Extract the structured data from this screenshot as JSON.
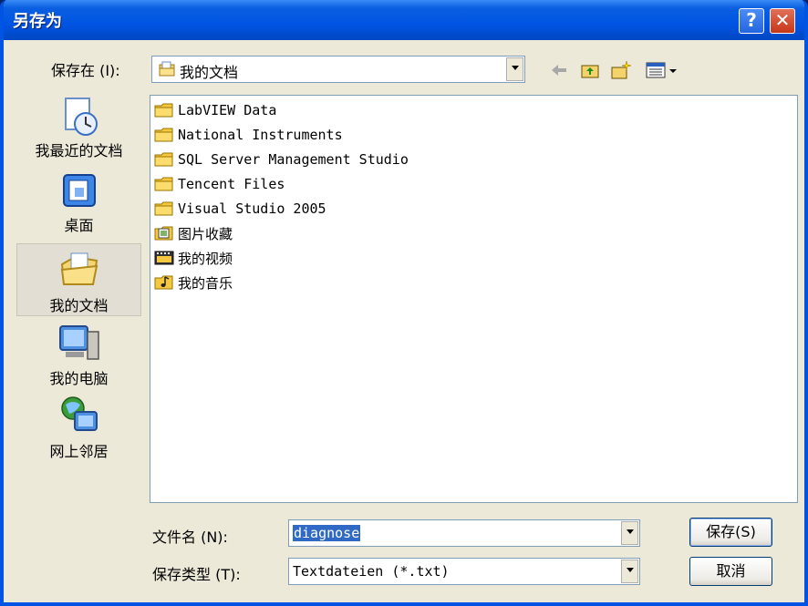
{
  "window": {
    "title": "另存为"
  },
  "titlebar": {
    "help_label": "?",
    "close_label": "✕"
  },
  "save_in": {
    "label": "保存在 (I):",
    "value": "我的文档"
  },
  "places": [
    {
      "label": "我最近的文档",
      "icon": "recent-documents-icon"
    },
    {
      "label": "桌面",
      "icon": "desktop-icon"
    },
    {
      "label": "我的文档",
      "icon": "my-documents-icon",
      "selected": true
    },
    {
      "label": "我的电脑",
      "icon": "my-computer-icon"
    },
    {
      "label": "网上邻居",
      "icon": "network-places-icon"
    }
  ],
  "files": [
    {
      "name": "LabVIEW Data",
      "icon": "folder-icon"
    },
    {
      "name": "National Instruments",
      "icon": "folder-icon"
    },
    {
      "name": "SQL Server Management Studio",
      "icon": "folder-icon"
    },
    {
      "name": "Tencent Files",
      "icon": "folder-icon"
    },
    {
      "name": "Visual Studio 2005",
      "icon": "folder-icon"
    },
    {
      "name": "图片收藏",
      "icon": "my-pictures-icon"
    },
    {
      "name": "我的视频",
      "icon": "my-videos-icon"
    },
    {
      "name": "我的音乐",
      "icon": "my-music-icon"
    }
  ],
  "filename": {
    "label": "文件名 (N):",
    "value": "diagnose"
  },
  "filetype": {
    "label": "保存类型 (T):",
    "value": "Textdateien (*.txt)"
  },
  "buttons": {
    "save": "保存(S)",
    "cancel": "取消"
  },
  "colors": {
    "titlebar": "#0054e3",
    "dialog_bg": "#ece9d8",
    "selection": "#316ac5",
    "folder": "#f5c842"
  }
}
